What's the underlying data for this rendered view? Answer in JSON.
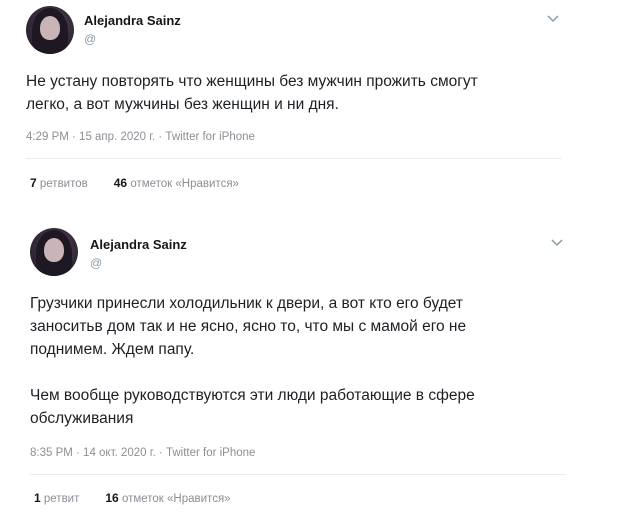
{
  "tweets": [
    {
      "name": "Alejandra Sainz",
      "handle": "@",
      "text": "Не устану повторять что женщины без мужчин прожить смогут\nлегко, а вот мужчины без женщин и ни дня.",
      "meta": "4:29 PM · 15 апр. 2020 г. · Twitter for iPhone",
      "retweets_count": "7",
      "retweets_label": "ретвитов",
      "likes_count": "46",
      "likes_label": "отметок «Нравится»"
    },
    {
      "name": "Alejandra Sainz",
      "handle": "@",
      "text": "Грузчики принесли холодильник к двери, а вот кто его будет\nзаноситьв дом так и не ясно, ясно то, что мы с мамой его не\nподнимем. Ждем папу.\n\nЧем вообще руководствуются эти люди работающие в сфере\nобслуживания",
      "meta": "8:35 PM · 14 окт. 2020 г. · Twitter for iPhone",
      "retweets_count": "1",
      "retweets_label": "ретвит",
      "likes_count": "16",
      "likes_label": "отметок «Нравится»"
    }
  ],
  "icons": {
    "more": "chevron-down-icon"
  },
  "colors": {
    "text": "#14171a",
    "secondary": "#8899a6",
    "divider": "#e6ecf0"
  }
}
